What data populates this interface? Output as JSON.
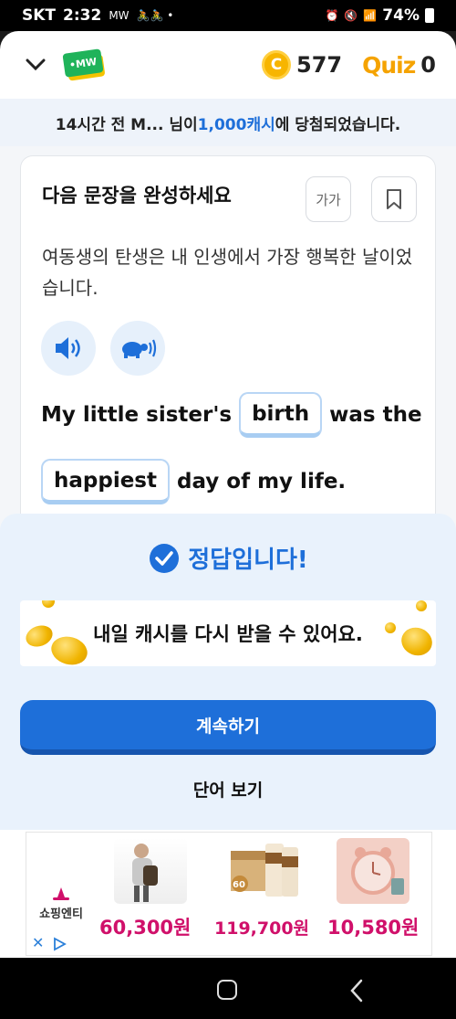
{
  "status": {
    "carrier": "SKT",
    "time": "2:32",
    "small_icons": "MW",
    "battery": "74%"
  },
  "header": {
    "coins": "577",
    "quiz_logo": "Quiz",
    "quiz_count": "0",
    "coin_symbol": "C"
  },
  "ticker": {
    "prefix": "14시간 전 M... 님이 ",
    "amount": "1,000캐시",
    "suffix": "에 당첨되었습니다."
  },
  "question": {
    "title": "다음 문장을 완성하세요",
    "font_button": "가가",
    "korean": "여동생의 탄생은 내 인생에서 가장 행복한 날이었습니다.",
    "sentence_line1_before": "My little sister's",
    "blank1": "birth",
    "sentence_line1_after": "was the",
    "blank2": "happiest",
    "sentence_line2_after": "day of my life."
  },
  "result": {
    "correct_label": "정답입니다!",
    "banner_text": "내일 캐시를 다시 받을 수 있어요.",
    "continue_label": "계속하기",
    "words_label": "단어 보기"
  },
  "ad": {
    "brand": "쇼핑엔티",
    "products": [
      {
        "price": "60,300원",
        "badge": ""
      },
      {
        "price": "119,700원",
        "badge": "60"
      },
      {
        "price": "10,580원",
        "badge": ""
      }
    ]
  },
  "colors": {
    "accent": "#1e6fd9",
    "price": "#d0106a",
    "coin": "#f7b500"
  }
}
